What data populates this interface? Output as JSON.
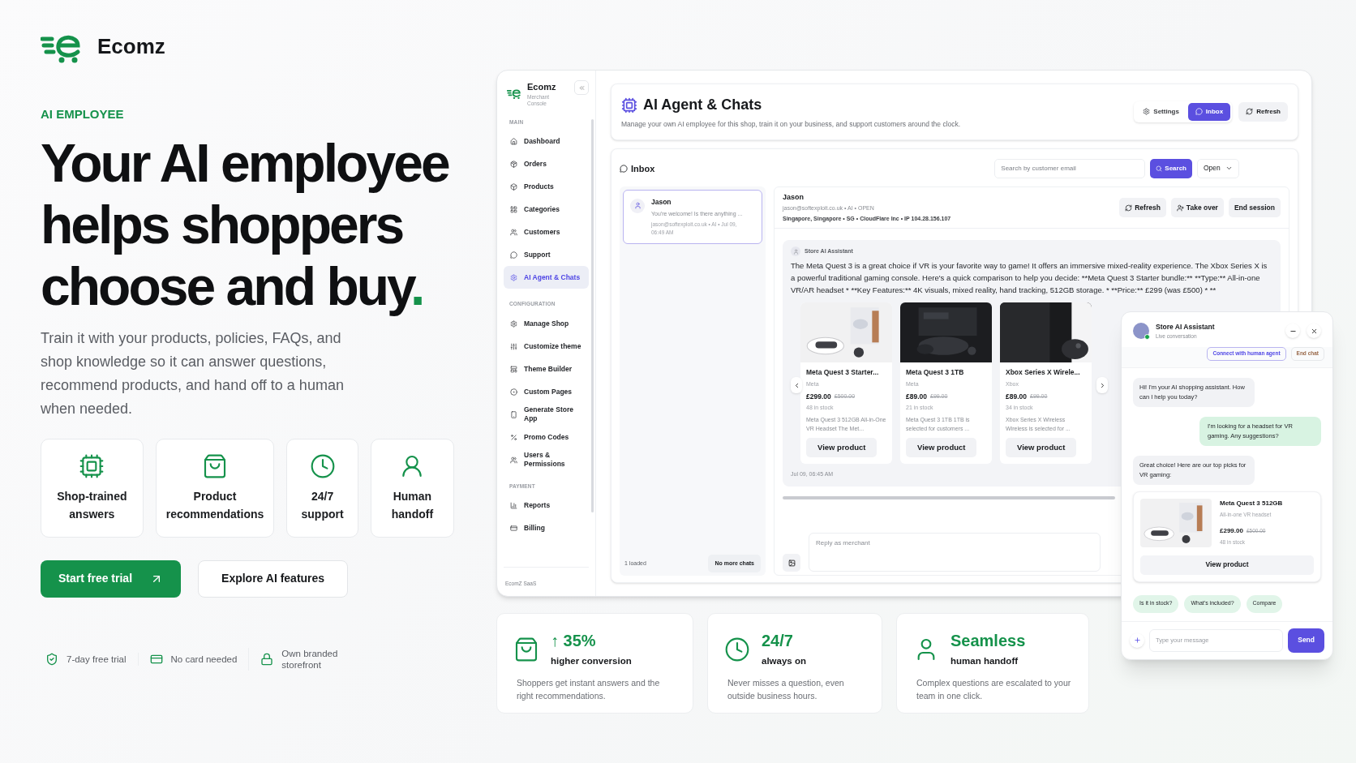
{
  "brand": {
    "name": "Ecomz"
  },
  "hero": {
    "eyebrow": "AI EMPLOYEE",
    "headline_lines": [
      "Your AI employee",
      "helps shoppers",
      "choose and buy"
    ],
    "headline_dot": ".",
    "body": "Train it with your products, policies, FAQs, and shop knowledge so it can answer questions, recommend products, and hand off to a human when needed."
  },
  "features": [
    {
      "label": "Shop-trained answers"
    },
    {
      "label": "Product recommendations"
    },
    {
      "label": "24/7 support"
    },
    {
      "label": "Human handoff"
    }
  ],
  "ctas": [
    {
      "label": "Start free trial",
      "kind": "primary"
    },
    {
      "label": "Explore AI features",
      "kind": "secondary"
    }
  ],
  "perks": [
    {
      "label": "7-day free trial"
    },
    {
      "label": "No card needed"
    },
    {
      "label": "Own branded storefront"
    }
  ],
  "console": {
    "sidebar": {
      "brand": "Ecomz",
      "subtitle": "Merchant Console",
      "sections": [
        {
          "title": "MAIN",
          "items": [
            {
              "label": "Dashboard",
              "selected": false
            },
            {
              "label": "Orders",
              "selected": false
            },
            {
              "label": "Products",
              "selected": false
            },
            {
              "label": "Categories",
              "selected": false
            },
            {
              "label": "Customers",
              "selected": false
            },
            {
              "label": "Support",
              "selected": false
            },
            {
              "label": "AI Agent & Chats",
              "selected": true
            }
          ]
        },
        {
          "title": "CONFIGURATION",
          "items": [
            {
              "label": "Manage Shop",
              "selected": false
            },
            {
              "label": "Customize theme",
              "selected": false
            },
            {
              "label": "Theme Builder",
              "selected": false
            },
            {
              "label": "Custom Pages",
              "selected": false
            },
            {
              "label": "Generate Store App",
              "selected": false
            },
            {
              "label": "Promo Codes",
              "selected": false
            },
            {
              "label": "Users & Permissions",
              "selected": false
            }
          ]
        },
        {
          "title": "PAYMENT",
          "items": [
            {
              "label": "Reports",
              "selected": false
            },
            {
              "label": "Billing",
              "selected": false
            }
          ]
        }
      ],
      "footer": "EcomZ SaaS"
    },
    "header": {
      "title": "AI Agent & Chats",
      "description": "Manage your own AI employee for this shop, train it on your business, and support customers around the clock.",
      "tabs": [
        {
          "label": "Settings",
          "selected": false
        },
        {
          "label": "Inbox",
          "selected": true
        }
      ],
      "refresh": "Refresh"
    },
    "inbox": {
      "title": "Inbox",
      "search_placeholder": "Search by customer email",
      "search_button": "Search",
      "filter": "Open",
      "chats": [
        {
          "name": "Jason",
          "preview": "You're welcome! Is there anything ...",
          "meta": "jason@softexploit.co.uk • AI • Jul 09, 06:49 AM",
          "selected": true
        }
      ],
      "loaded": "1 loaded",
      "no_more": "No more chats"
    },
    "conversation": {
      "name": "Jason",
      "meta": "jason@softexploit.co.uk • AI • OPEN",
      "location": "Singapore, Singapore • SG • CloudFlare Inc • IP 104.28.156.107",
      "actions": [
        "Refresh",
        "Take over",
        "End session"
      ],
      "message": {
        "sender": "Store AI Assistant",
        "text": "The Meta Quest 3 is a great choice if VR is your favorite way to game! It offers an immersive mixed-reality experience. The Xbox Series X is a powerful traditional gaming console. Here's a quick comparison to help you decide: **Meta Quest 3 Starter bundle:** **Type:** All-in-one VR/AR headset * **Key Features:** 4K visuals, mixed reality, hand tracking, 512GB storage. * **Price:** £299 (was £500) * **",
        "time": "Jul 09, 06:45 AM",
        "products": [
          {
            "name": "Meta Quest 3 Starter...",
            "brand": "Meta",
            "price": "£299.00",
            "old_price": "£500.00",
            "stock": "48 in stock",
            "description": "Meta Quest 3 512GB All-in-One VR Headset The Met...",
            "button": "View product"
          },
          {
            "name": "Meta Quest 3 1TB",
            "brand": "Meta",
            "price": "£89.00",
            "old_price": "£99.00",
            "stock": "21 in stock",
            "description": "Meta Quest 3 1TB 1TB is selected for customers ...",
            "button": "View product"
          },
          {
            "name": "Xbox Series X Wirele...",
            "brand": "Xbox",
            "price": "£89.00",
            "old_price": "£99.00",
            "stock": "34 in stock",
            "description": "Xbox Series X Wireless Wireless is selected for ...",
            "button": "View product"
          }
        ]
      },
      "reply_placeholder": "Reply as merchant"
    }
  },
  "widget": {
    "title": "Store AI Assistant",
    "subtitle": "Live conversation",
    "connect": "Connect with human agent",
    "end": "End chat",
    "messages": [
      {
        "kind": "bot",
        "text": "Hi! I'm your AI shopping assistant. How can I help you today?"
      },
      {
        "kind": "user",
        "text": "I'm looking for a headset for VR gaming. Any suggestions?"
      },
      {
        "kind": "bot",
        "text": "Great choice! Here are our top picks for VR gaming:"
      }
    ],
    "product": {
      "name": "Meta Quest 3 512GB",
      "description": "All-in-one VR headset",
      "price": "£299.00",
      "old_price": "£500.00",
      "stock": "48 in stock",
      "button": "View product"
    },
    "suggestions": [
      "Is it in stock?",
      "What's included?",
      "Compare"
    ],
    "placeholder": "Type your message",
    "send": "Send"
  },
  "stats": [
    {
      "value": "↑ 35%",
      "heading": "higher conversion",
      "body": "Shoppers get instant answers and the right recommendations."
    },
    {
      "value": "24/7",
      "heading": "always on",
      "body": "Never misses a question, even outside business hours."
    },
    {
      "value": "Seamless",
      "heading": "human handoff",
      "body": "Complex questions are escalated to your team in one click."
    }
  ]
}
